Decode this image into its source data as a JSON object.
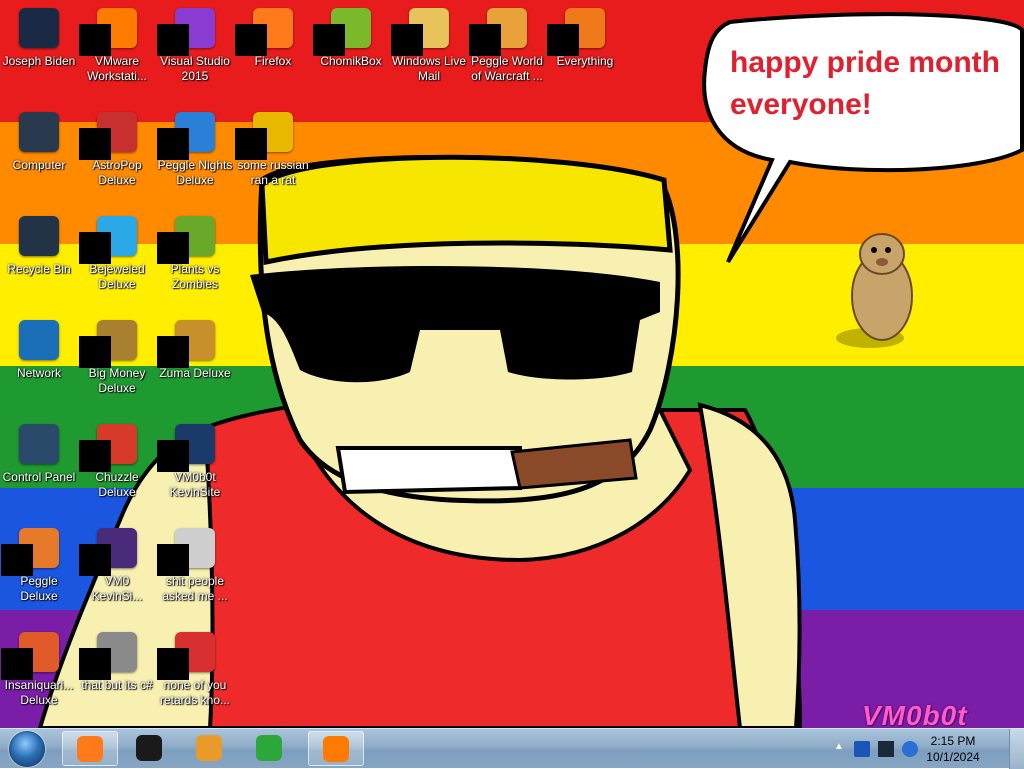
{
  "wallpaper": {
    "stripes": [
      "#e81c1c",
      "#ff8a00",
      "#ffee00",
      "#1f9a30",
      "#1a56e0",
      "#7a1ea8"
    ],
    "bubble_text": "happy pride month everyone!",
    "watermark": "VM0b0t"
  },
  "desktop_icons": [
    {
      "label": "Joseph Biden",
      "icon": "pc-tower-icon",
      "color": "#1b2a44"
    },
    {
      "label": "VMware Workstati...",
      "icon": "vmware-icon",
      "color": "#ff7b00"
    },
    {
      "label": "Visual Studio 2015",
      "icon": "visual-studio-icon",
      "color": "#8a3bd1"
    },
    {
      "label": "Firefox",
      "icon": "firefox-icon",
      "color": "#ff7a1a"
    },
    {
      "label": "ChomikBox",
      "icon": "hamster-icon",
      "color": "#7bb82a"
    },
    {
      "label": "Windows Live Mail",
      "icon": "mail-icon",
      "color": "#e8c25a"
    },
    {
      "label": "Peggle World of Warcraft ...",
      "icon": "peggle-icon",
      "color": "#e9a23a"
    },
    {
      "label": "Everything",
      "icon": "search-icon",
      "color": "#f07a1a"
    },
    {
      "label": "Computer",
      "icon": "monitor-icon",
      "color": "#2a3a4e"
    },
    {
      "label": "AstroPop Deluxe",
      "icon": "astropop-icon",
      "color": "#c83030"
    },
    {
      "label": "Peggle Nights Deluxe",
      "icon": "peggle-nights-icon",
      "color": "#2a7fd6"
    },
    {
      "label": "some russian ran a rat",
      "icon": "file-icon",
      "color": "#e8b800"
    },
    {
      "label": "Recycle Bin",
      "icon": "recycle-bin-icon",
      "color": "#233347"
    },
    {
      "label": "Bejeweled Deluxe",
      "icon": "gem-icon",
      "color": "#2aa8e8"
    },
    {
      "label": "Plants vs Zombies",
      "icon": "plant-icon",
      "color": "#6aa82a"
    },
    {
      "label": "Network",
      "icon": "globe-icon",
      "color": "#1a6fb8"
    },
    {
      "label": "Big Money Deluxe",
      "icon": "money-bag-icon",
      "color": "#a88030"
    },
    {
      "label": "Zuma Deluxe",
      "icon": "zuma-icon",
      "color": "#c8902a"
    },
    {
      "label": "Control Panel",
      "icon": "control-panel-icon",
      "color": "#2a4a6a"
    },
    {
      "label": "Chuzzle Deluxe",
      "icon": "chuzzle-icon",
      "color": "#d83a2a"
    },
    {
      "label": "VM0b0t KevinSite",
      "icon": "folder-icon",
      "color": "#1a3a6a"
    },
    {
      "label": "Peggle Deluxe",
      "icon": "peggle-icon",
      "color": "#e67a2a"
    },
    {
      "label": "VM0 KevinSi...",
      "icon": "document-icon",
      "color": "#4a2a7a"
    },
    {
      "label": "shit people asked me ...",
      "icon": "text-file-icon",
      "color": "#cfcfcf"
    },
    {
      "label": "Insaniquari... Deluxe",
      "icon": "fish-icon",
      "color": "#e05a2a"
    },
    {
      "label": "that but its c#",
      "icon": "shortcut-icon",
      "color": "#8a8a8a"
    },
    {
      "label": "none of you retards kno...",
      "icon": "media-icon",
      "color": "#d83030"
    }
  ],
  "taskbar": {
    "buttons": [
      {
        "name": "firefox-taskbar-icon",
        "color": "#ff7a1a"
      },
      {
        "name": "cmd-taskbar-icon",
        "color": "#1a1a1a"
      },
      {
        "name": "media-player-taskbar-icon",
        "color": "#e89a2a"
      },
      {
        "name": "internet-download-taskbar-icon",
        "color": "#2aa83a"
      },
      {
        "name": "vmware-taskbar-icon",
        "color": "#ff7b00"
      }
    ],
    "clock_time": "2:15 PM",
    "clock_date": "10/1/2024"
  }
}
